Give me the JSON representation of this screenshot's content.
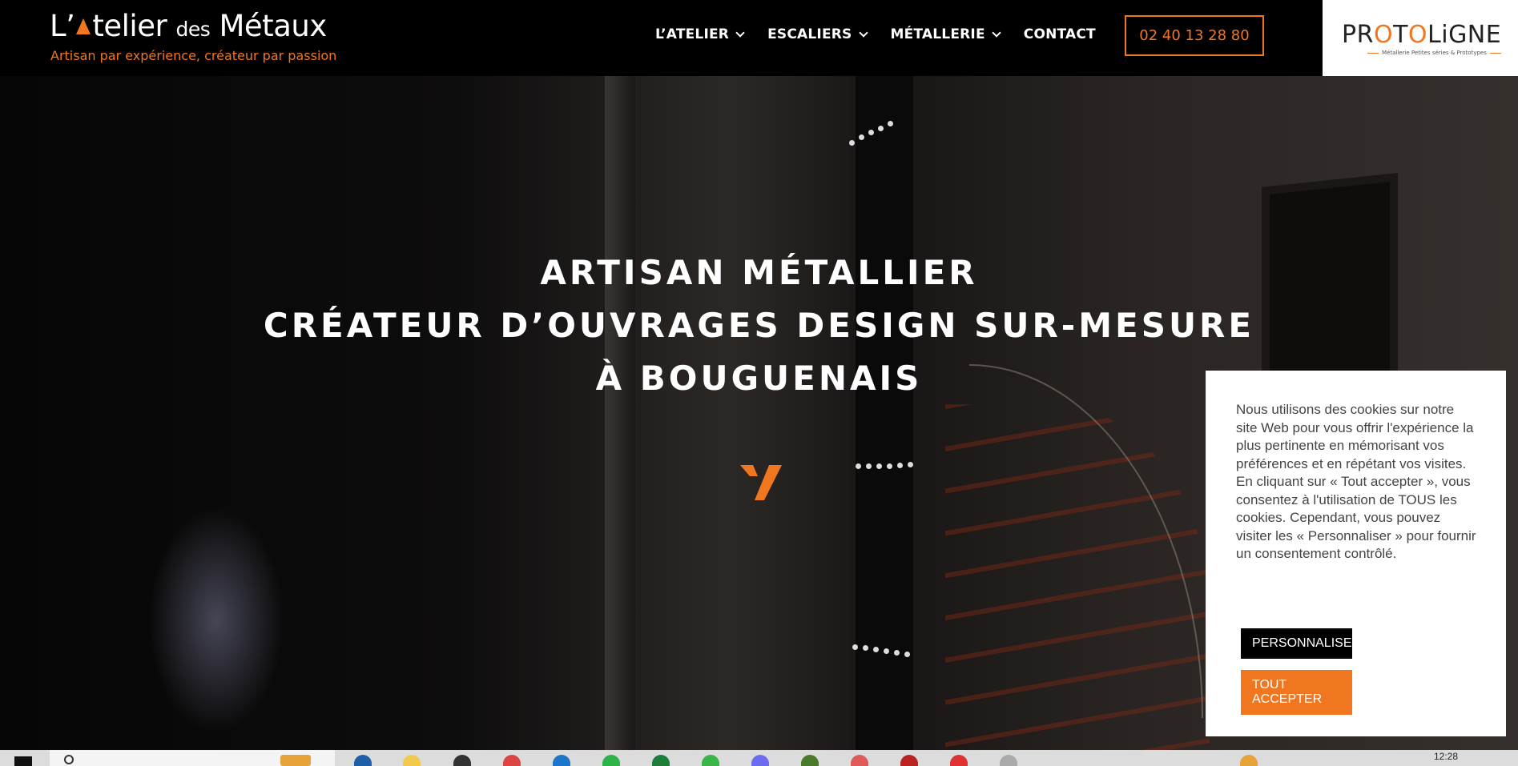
{
  "header": {
    "logo": {
      "title_prefix": "L’",
      "title_main": "telier",
      "title_mid": "des",
      "title_end": "Métaux",
      "tagline": "Artisan par expérience, créateur par passion"
    },
    "nav": [
      {
        "label": "L’ATELIER",
        "has_dropdown": true
      },
      {
        "label": "ESCALIERS",
        "has_dropdown": true
      },
      {
        "label": "MÉTALLERIE",
        "has_dropdown": true
      },
      {
        "label": "CONTACT",
        "has_dropdown": false
      }
    ],
    "phone": "02 40 13 28 80",
    "partner": {
      "name_a": "PR",
      "name_o": "O",
      "name_b": "T",
      "name_o2": "O",
      "name_c": "LiGNE",
      "sub": "Métallerie Petites séries & Prototypes"
    }
  },
  "hero": {
    "lines": [
      "ARTISAN MÉTALLIER",
      "CRÉATEUR D’OUVRAGES DESIGN SUR-MESURE",
      "À BOUGUENAIS"
    ]
  },
  "cookie": {
    "text": "Nous utilisons des cookies sur notre site Web pour vous offrir l'expérience la plus pertinente en mémorisant vos préférences et en répétant vos visites. En cliquant sur « Tout accepter », vous consentez à l'utilisation de TOUS les cookies. Cependant, vous pouvez visiter les « Personnaliser » pour fournir un consentement contrôlé.",
    "customize_label": "PERSONNALISER",
    "accept_label": "TOUT ACCEPTER"
  },
  "taskbar": {
    "clock": "12:28"
  },
  "colors": {
    "accent": "#f0761f",
    "header_bg": "#000000"
  }
}
